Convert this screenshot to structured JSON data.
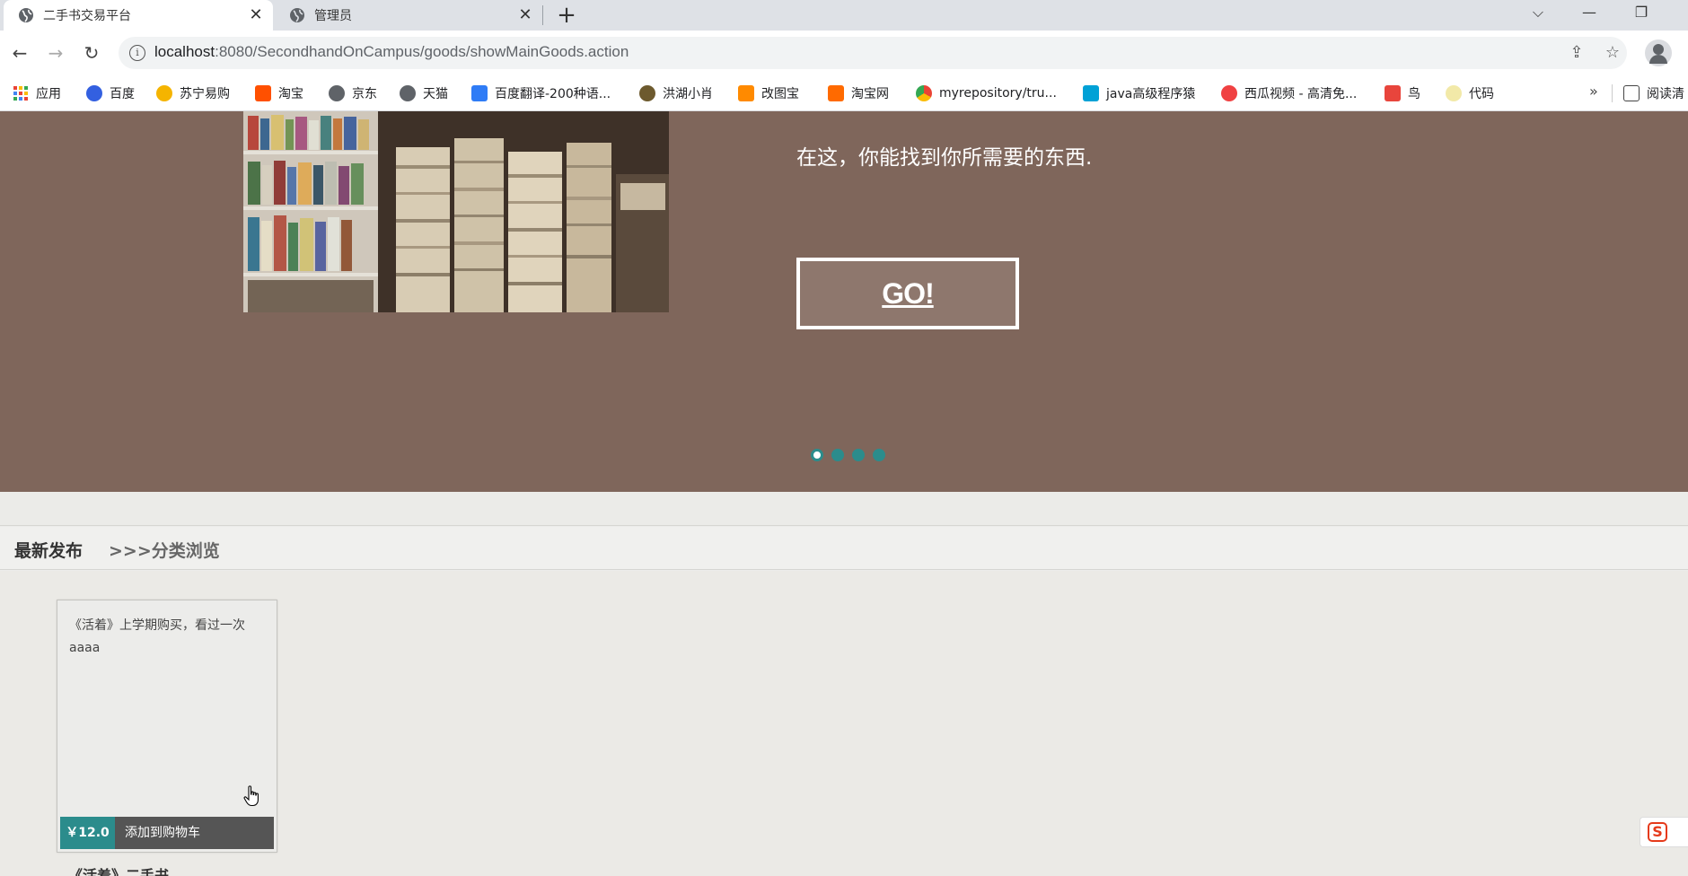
{
  "browser": {
    "tabs": [
      {
        "title": "二手书交易平台",
        "active": true
      },
      {
        "title": "管理员",
        "active": false
      }
    ],
    "new_tab": "+",
    "url_host": "localhost",
    "url_rest": ":8080/SecondhandOnCampus/goods/showMainGoods.action",
    "bookmarks": [
      {
        "label": "应用",
        "color": "#1a73e8"
      },
      {
        "label": "百度",
        "color": "#3360e0"
      },
      {
        "label": "苏宁易购",
        "color": "#f5b400"
      },
      {
        "label": "淘宝",
        "color": "#ff5000"
      },
      {
        "label": "京东",
        "color": "#5f6368"
      },
      {
        "label": "天猫",
        "color": "#5f6368"
      },
      {
        "label": "百度翻译-200种语...",
        "color": "#2f7cf6"
      },
      {
        "label": "洪湖小肖",
        "color": "#6d5a2e"
      },
      {
        "label": "改图宝",
        "color": "#ff8a00"
      },
      {
        "label": "淘宝网",
        "color": "#ff6a00"
      },
      {
        "label": "myrepository/tru...",
        "color": "#34a853"
      },
      {
        "label": "java高级程序猿",
        "color": "#00a1d6"
      },
      {
        "label": "西瓜视频 - 高清免...",
        "color": "#f04142"
      },
      {
        "label": "鸟",
        "color": "#e8453c"
      },
      {
        "label": "代码",
        "color": "#f2e9a8"
      }
    ],
    "more": "»",
    "reading_list": "阅读清"
  },
  "hero": {
    "tagline": "在这，你能找到你所需要的东西.",
    "go_label": "GO!",
    "slide_count": 4,
    "active_slide": 0
  },
  "section_nav": {
    "latest": "最新发布",
    "browse": ">>>分类浏览"
  },
  "goods": [
    {
      "line1": "《活着》上学期购买，看过一次",
      "line2": "aaaa",
      "price": "￥12.0",
      "cart_label": "添加到购物车",
      "title": "《活着》二手书"
    }
  ]
}
